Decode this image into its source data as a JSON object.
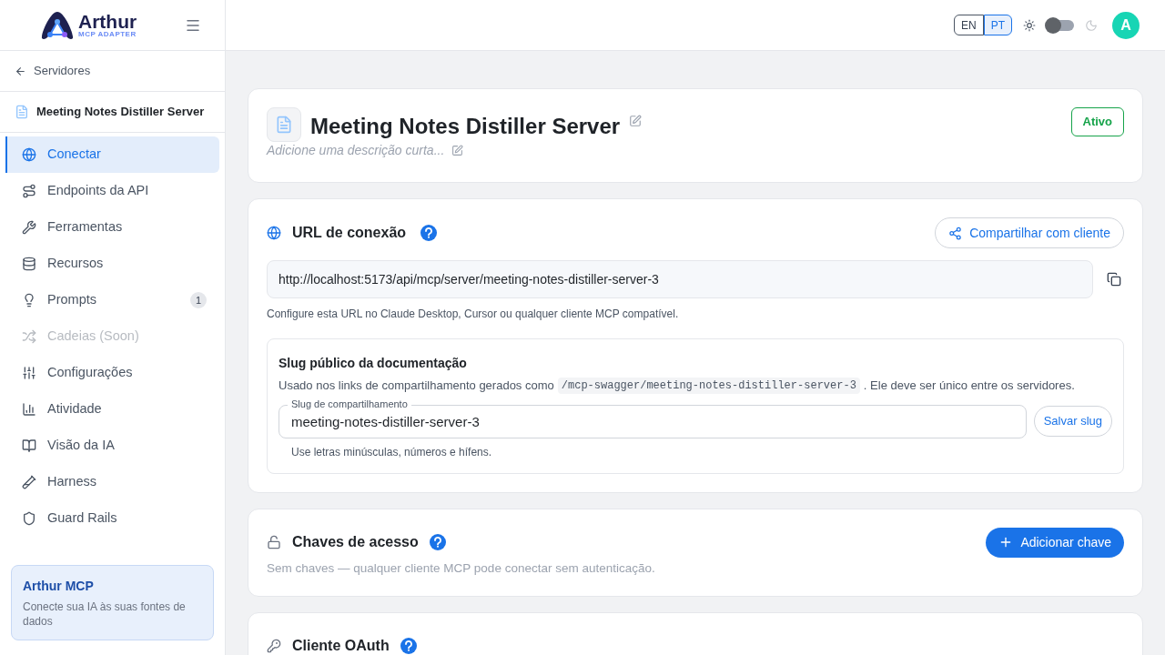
{
  "brand": {
    "name": "Arthur",
    "tagline": "MCP ADAPTER"
  },
  "header": {
    "languages": [
      {
        "label": "EN",
        "selected": false
      },
      {
        "label": "PT",
        "selected": true
      }
    ],
    "dark_mode": false,
    "avatar": "A"
  },
  "sidebar": {
    "back": "Servidores",
    "server": "Meeting Notes Distiller Server",
    "items": [
      {
        "label": "Conectar",
        "selected": true,
        "disabled": false
      },
      {
        "label": "Endpoints da API",
        "selected": false,
        "disabled": false
      },
      {
        "label": "Ferramentas",
        "selected": false,
        "disabled": false
      },
      {
        "label": "Recursos",
        "selected": false,
        "disabled": false
      },
      {
        "label": "Prompts",
        "selected": false,
        "disabled": false,
        "badge": "1"
      },
      {
        "label": "Cadeias (Soon)",
        "selected": false,
        "disabled": true
      },
      {
        "label": "Configurações",
        "selected": false,
        "disabled": false
      },
      {
        "label": "Atividade",
        "selected": false,
        "disabled": false
      },
      {
        "label": "Visão da IA",
        "selected": false,
        "disabled": false
      },
      {
        "label": "Harness",
        "selected": false,
        "disabled": false
      },
      {
        "label": "Guard Rails",
        "selected": false,
        "disabled": false
      }
    ],
    "promo": {
      "title": "Arthur MCP",
      "text": "Conecte sua IA às suas fontes de dados"
    }
  },
  "server_card": {
    "title": "Meeting Notes Distiller Server",
    "description_placeholder": "Adicione uma descrição curta...",
    "status": "Ativo"
  },
  "connection": {
    "title": "URL de conexão",
    "share_button": "Compartilhar com cliente",
    "url": "http://localhost:5173/api/mcp/server/meeting-notes-distiller-server-3",
    "hint": "Configure esta URL no Claude Desktop, Cursor ou qualquer cliente MCP compatível.",
    "slug": {
      "title": "Slug público da documentação",
      "text_before": "Usado nos links de compartilhamento gerados como",
      "code": "/mcp-swagger/meeting-notes-distiller-server-3",
      "text_after": ". Ele deve ser único entre os servidores.",
      "field_label": "Slug de compartilhamento",
      "value": "meeting-notes-distiller-server-3",
      "save_button": "Salvar slug",
      "hint": "Use letras minúsculas, números e hífens."
    }
  },
  "access_keys": {
    "title": "Chaves de acesso",
    "add_button": "Adicionar chave",
    "empty": "Sem chaves — qualquer cliente MCP pode conectar sem autenticação."
  },
  "oauth": {
    "title": "Cliente OAuth"
  }
}
